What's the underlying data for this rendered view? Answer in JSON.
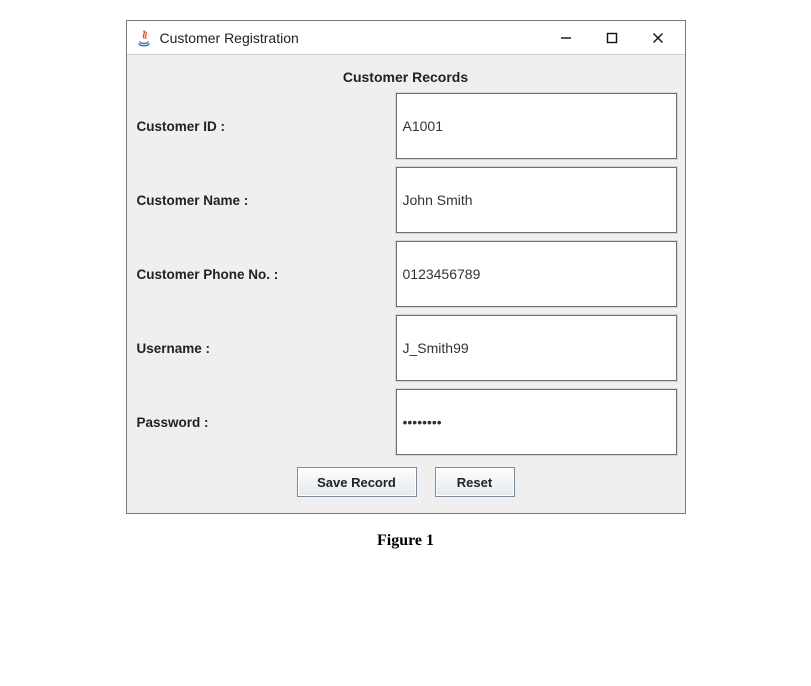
{
  "window": {
    "title": "Customer Registration"
  },
  "header": {
    "subtitle": "Customer Records"
  },
  "fields": {
    "customer_id": {
      "label": "Customer ID :",
      "value": "A1001"
    },
    "customer_name": {
      "label": "Customer Name :",
      "value": "John Smith"
    },
    "customer_phone": {
      "label": "Customer Phone No. :",
      "value": "0123456789"
    },
    "username": {
      "label": "Username :",
      "value": "J_Smith99"
    },
    "password": {
      "label": "Password :",
      "value": "••••••••"
    }
  },
  "buttons": {
    "save": "Save Record",
    "reset": "Reset"
  },
  "caption": "Figure 1"
}
